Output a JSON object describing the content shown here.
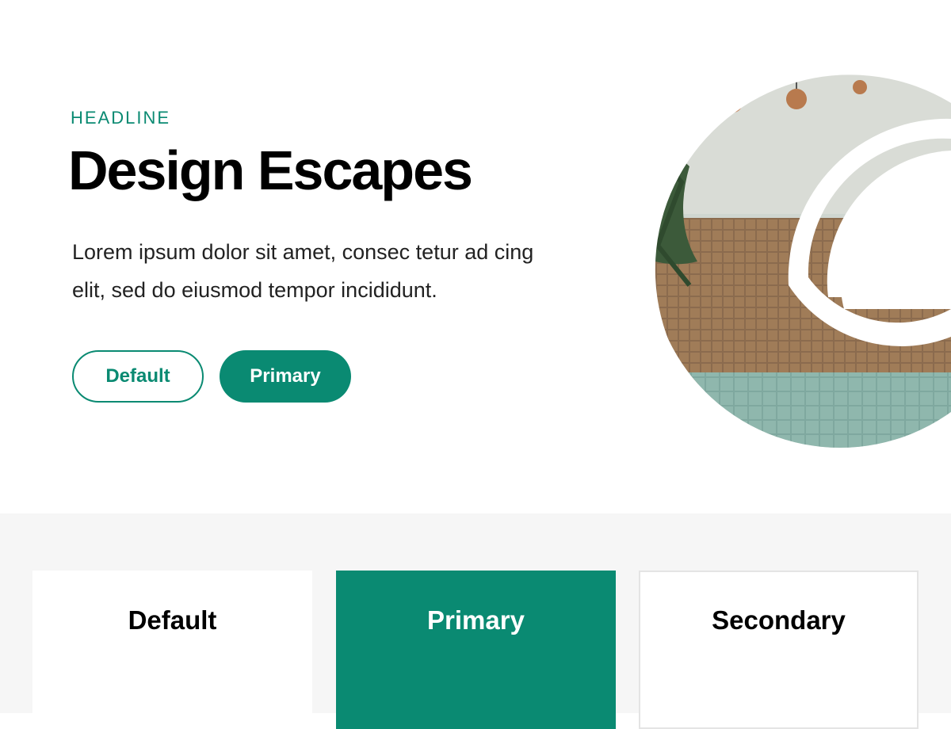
{
  "hero": {
    "eyebrow": "HEADLINE",
    "title": "Design Escapes",
    "body": "Lorem ipsum dolor sit amet, consec tetur ad cing elit, sed do eiusmod tempor incididunt.",
    "buttons": {
      "default_label": "Default",
      "primary_label": "Primary"
    },
    "image": {
      "description_icon": "pool-photo"
    }
  },
  "cards": [
    {
      "label": "Default"
    },
    {
      "label": "Primary"
    },
    {
      "label": "Secondary"
    }
  ],
  "colors": {
    "accent": "#0a8a72",
    "section_background": "#f6f6f6",
    "text": "#000000"
  }
}
